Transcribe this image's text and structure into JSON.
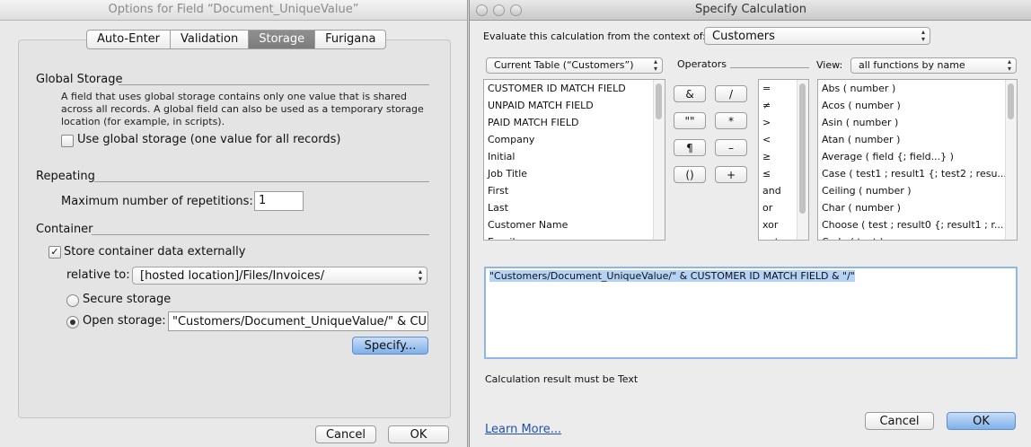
{
  "left_window": {
    "title": "Options for Field “Document_UniqueValue”",
    "tabs": [
      {
        "label": "Auto-Enter",
        "selected": false
      },
      {
        "label": "Validation",
        "selected": false
      },
      {
        "label": "Storage",
        "selected": true
      },
      {
        "label": "Furigana",
        "selected": false
      }
    ],
    "global_storage": {
      "title": "Global Storage",
      "desc_lines": [
        "A field that uses global storage contains only one value that is shared",
        "across all records.  A global field can also be used as a temporary storage",
        "location (for example, in scripts)."
      ],
      "checkbox_label": "Use global storage (one value for all records)",
      "checked": false
    },
    "repeating": {
      "title": "Repeating",
      "label": "Maximum number of repetitions:",
      "value": "1"
    },
    "container": {
      "title": "Container",
      "store_external_label": "Store container data externally",
      "store_external_checked": true,
      "check_mark": "✓",
      "relative_to_label": "relative to:",
      "relative_to_value": "[hosted location]/Files/Invoices/",
      "secure_label": "Secure storage",
      "open_label": "Open storage:",
      "open_value": "\"Customers/Document_UniqueValue/\" & CUS",
      "specify_label": "Specify..."
    },
    "buttons": {
      "cancel": "Cancel",
      "ok": "OK"
    }
  },
  "right_window": {
    "title": "Specify Calculation",
    "context_label": "Evaluate this calculation from the context of:",
    "context_value": "Customers",
    "table_popup": "Current Table (“Customers”)",
    "fields": [
      "CUSTOMER ID MATCH FIELD",
      "UNPAID MATCH FIELD",
      "PAID MATCH FIELD",
      "Company",
      "Initial",
      "Job Title",
      "First",
      "Last",
      "Customer Name",
      "Email"
    ],
    "operators_label": "Operators",
    "operator_buttons": [
      "&",
      "/",
      "\"\"",
      "*",
      "¶",
      "–",
      "()",
      "+"
    ],
    "operator_list": [
      "=",
      "≠",
      ">",
      "<",
      "≥",
      "≤",
      "and",
      "or",
      "xor",
      "not"
    ],
    "view_label": "View:",
    "view_value": "all functions by name",
    "functions": [
      "Abs ( number )",
      "Acos ( number )",
      "Asin ( number )",
      "Atan ( number )",
      "Average ( field {; field...} )",
      "Case ( test1 ; result1 {; test2 ; resu...",
      "Ceiling ( number )",
      "Char ( number )",
      "Choose ( test ; result0 {; result1 ; r...",
      "Code ( text )"
    ],
    "formula": "\"Customers/Document_UniqueValue/\" & CUSTOMER ID MATCH FIELD & \"/\"",
    "result_label": "Calculation result must be Text",
    "learn_more": "Learn More...",
    "buttons": {
      "cancel": "Cancel",
      "ok": "OK"
    }
  },
  "icons": {
    "popup_arrows": "▴▾",
    "checkbox_check": "check-icon",
    "traffic_lights": "window-control-icon"
  },
  "colors": {
    "accent_blue": "#7fb0ea",
    "selection": "#b5d3f7",
    "link": "#2250a8"
  }
}
